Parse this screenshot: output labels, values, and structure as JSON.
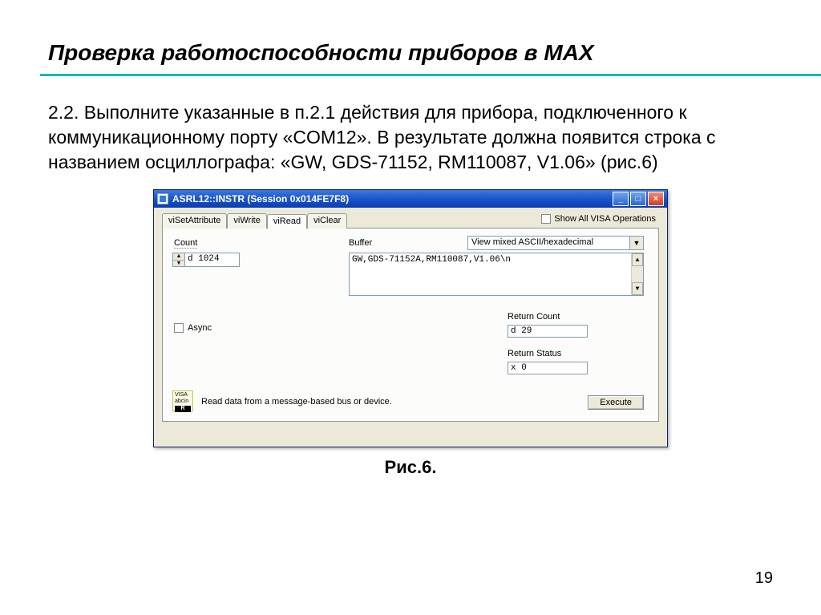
{
  "slide": {
    "title": "Проверка работоспособности  приборов в MAX",
    "body": "2.2. Выполните указанные в п.2.1 действия для прибора, подключенного к коммуникационному порту «COM12». В результате должна появится строка с названием осциллографа: «GW, GDS-71152, RM110087, V1.06» (рис.6)",
    "caption": "Рис.6.",
    "page": "19"
  },
  "dialog": {
    "title": "ASRL12::INSTR (Session 0x014FE7F8)",
    "tabs": [
      "viSetAttribute",
      "viWrite",
      "viRead",
      "viClear"
    ],
    "active_tab": 2,
    "show_all_label": "Show All VISA Operations",
    "count_label": "Count",
    "count_value": "d 1024",
    "buffer_label": "Buffer",
    "view_mode": "View mixed ASCII/hexadecimal",
    "buffer_text": "GW,GDS-71152A,RM110087,V1.06\\n",
    "async_label": "Async",
    "return_count_label": "Return Count",
    "return_count_value": "d 29",
    "return_status_label": "Return Status",
    "return_status_value": "x 0",
    "hint": "Read data from a message-based bus or device.",
    "execute": "Execute",
    "winbtns": {
      "min": "_",
      "max": "□",
      "close": "×"
    },
    "hinticon_top": "VISA abc\\n",
    "hinticon_r": "R"
  }
}
